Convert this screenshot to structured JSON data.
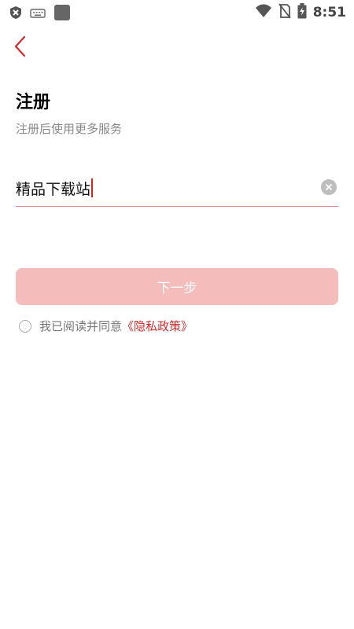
{
  "status_bar": {
    "time": "8:51",
    "icons": [
      "shield-icon",
      "keyboard-icon",
      "app-square-icon",
      "wifi-icon",
      "no-sim-icon",
      "battery-charging-icon"
    ]
  },
  "nav": {
    "back_icon": "chevron-left-icon"
  },
  "page": {
    "title": "注册",
    "subtitle": "注册后使用更多服务"
  },
  "form": {
    "input_value": "精品下载站",
    "clear_icon": "clear-circle-icon"
  },
  "actions": {
    "next_label": "下一步",
    "agree_text": "我已阅读并同意",
    "policy_link": "《隐私政策》"
  },
  "colors": {
    "accent": "#d42a2a",
    "button_disabled": "#f4bcba",
    "underline": "#e88a86"
  }
}
